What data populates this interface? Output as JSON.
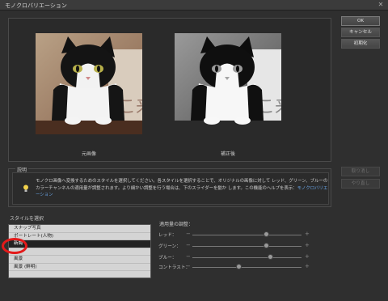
{
  "window": {
    "title": "モノクロバリエーション",
    "close_glyph": "✕"
  },
  "preview": {
    "before_caption": "元画像",
    "after_caption": "補正後"
  },
  "description": {
    "label": "説明",
    "text": "モノクロ画像へ変換するためのスタイルを選択してください。各スタイルを選択することで、オリジナルの画像に対して レッド、グリーン、ブルーのカラーチャンネルの適用量が調整されます。より細かい調整を行う場合は、下のスライダーを動か します。この機能のヘルプを表示：",
    "link": "モノクロバリエーション"
  },
  "style_section": {
    "label": "スタイルを選択",
    "items": [
      {
        "label": "スナップ写真",
        "selected": false
      },
      {
        "label": "ポートレート(人物)",
        "selected": false
      },
      {
        "label": "新聞",
        "selected": true
      },
      {
        "label": "",
        "selected": false
      },
      {
        "label": "風景",
        "selected": false
      },
      {
        "label": "風景 (鮮明)",
        "selected": false
      }
    ]
  },
  "adjust_section": {
    "label": "適用量の調整：",
    "sliders": [
      {
        "label": "レッド：",
        "minus": "−",
        "plus": "+",
        "value": 0.68
      },
      {
        "label": "グリーン：",
        "minus": "−",
        "plus": "+",
        "value": 0.68
      },
      {
        "label": "ブルー：",
        "minus": "−",
        "plus": "+",
        "value": 0.72
      },
      {
        "label": "コントラスト：",
        "minus": "−",
        "plus": "+",
        "value": 0.43
      }
    ]
  },
  "buttons": {
    "ok": "OK",
    "cancel": "キャンセル",
    "help": "初期化",
    "undo": "取り消し",
    "redo": "やり直し"
  },
  "colors": {
    "annotation": "#e31a1a",
    "link": "#6aa6e8"
  }
}
